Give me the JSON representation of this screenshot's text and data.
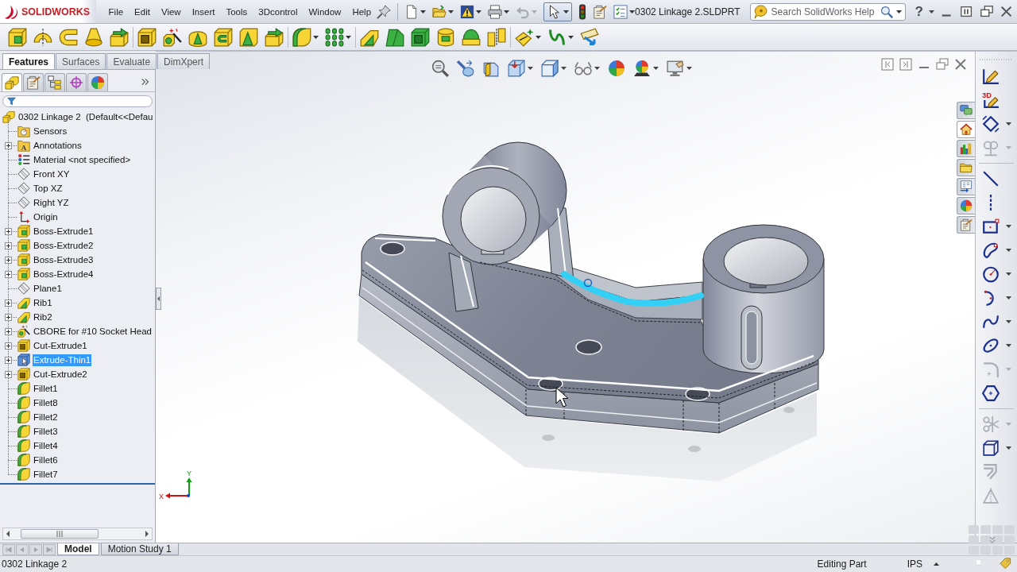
{
  "app": {
    "logo": "SOLIDWORKS"
  },
  "menu": [
    {
      "label": "File"
    },
    {
      "label": "Edit"
    },
    {
      "label": "View"
    },
    {
      "label": "Insert"
    },
    {
      "label": "Tools"
    },
    {
      "label": "3Dcontrol"
    },
    {
      "label": "Window"
    },
    {
      "label": "Help"
    }
  ],
  "quick_access": {
    "undo": {
      "disabled": true
    },
    "select": {
      "selected": true
    }
  },
  "document_title": "0302 Linkage 2.SLDPRT",
  "search": {
    "placeholder": "Search SolidWorks Help"
  },
  "help": {
    "label": "?"
  },
  "command_tabs": [
    {
      "label": "Features",
      "selected": true
    },
    {
      "label": "Surfaces",
      "selected": false
    },
    {
      "label": "Evaluate",
      "selected": false
    },
    {
      "label": "DimXpert",
      "selected": false
    }
  ],
  "manager_tabs": [
    {
      "selected": true
    },
    {
      "selected": false
    },
    {
      "selected": false
    },
    {
      "selected": false
    },
    {
      "selected": false
    }
  ],
  "feature_tree": {
    "root": {
      "label": "0302 Linkage 2  (Default<<Defau"
    },
    "items": [
      {
        "label": "Sensors",
        "kind": "sensors",
        "expandable": false,
        "selected": false
      },
      {
        "label": "Annotations",
        "kind": "annotations",
        "icon_text": "A",
        "expandable": true,
        "selected": false
      },
      {
        "label": "Material <not specified>",
        "kind": "material",
        "expandable": false,
        "selected": false
      },
      {
        "label": "Front XY",
        "kind": "plane",
        "expandable": false,
        "selected": false
      },
      {
        "label": "Top XZ",
        "kind": "plane",
        "expandable": false,
        "selected": false
      },
      {
        "label": "Right YZ",
        "kind": "plane",
        "expandable": false,
        "selected": false
      },
      {
        "label": "Origin",
        "kind": "origin",
        "expandable": false,
        "selected": false
      },
      {
        "label": "Boss-Extrude1",
        "kind": "boss",
        "expandable": true,
        "selected": false
      },
      {
        "label": "Boss-Extrude2",
        "kind": "boss",
        "expandable": true,
        "selected": false
      },
      {
        "label": "Boss-Extrude3",
        "kind": "boss",
        "expandable": true,
        "selected": false
      },
      {
        "label": "Boss-Extrude4",
        "kind": "boss",
        "expandable": true,
        "selected": false
      },
      {
        "label": "Plane1",
        "kind": "plane",
        "expandable": false,
        "selected": false
      },
      {
        "label": "Rib1",
        "kind": "rib",
        "expandable": true,
        "selected": false
      },
      {
        "label": "Rib2",
        "kind": "rib",
        "expandable": true,
        "selected": false
      },
      {
        "label": "CBORE for #10 Socket Head",
        "kind": "hole",
        "expandable": true,
        "selected": false
      },
      {
        "label": "Cut-Extrude1",
        "kind": "cut",
        "expandable": true,
        "selected": false
      },
      {
        "label": "Extrude-Thin1",
        "kind": "thin",
        "expandable": true,
        "selected": true
      },
      {
        "label": "Cut-Extrude2",
        "kind": "cut",
        "expandable": true,
        "selected": false
      },
      {
        "label": "Fillet1",
        "kind": "fillet",
        "expandable": false,
        "selected": false
      },
      {
        "label": "Fillet8",
        "kind": "fillet",
        "expandable": false,
        "selected": false
      },
      {
        "label": "Fillet2",
        "kind": "fillet",
        "expandable": false,
        "selected": false
      },
      {
        "label": "Fillet3",
        "kind": "fillet",
        "expandable": false,
        "selected": false
      },
      {
        "label": "Fillet4",
        "kind": "fillet",
        "expandable": false,
        "selected": false
      },
      {
        "label": "Fillet6",
        "kind": "fillet",
        "expandable": false,
        "selected": false
      },
      {
        "label": "Fillet7",
        "kind": "fillet",
        "expandable": false,
        "selected": false
      }
    ]
  },
  "part_model": {
    "highlighted": true
  },
  "triad": {
    "x_label": "X",
    "y_label": "Y"
  },
  "task_pane_tabs": [
    {
      "selected": false
    },
    {
      "selected": true
    },
    {
      "selected": false
    },
    {
      "selected": false
    },
    {
      "selected": false
    },
    {
      "selected": false
    },
    {
      "selected": false
    }
  ],
  "sketch_toolbar": [
    {
      "disabled": false
    },
    {
      "disabled": false,
      "badge": "3D"
    },
    {
      "disabled": false
    },
    {
      "disabled": true
    },
    {
      "disabled": false
    },
    {
      "disabled": false
    },
    {
      "disabled": false
    },
    {
      "disabled": false
    },
    {
      "disabled": false
    },
    {
      "disabled": false
    },
    {
      "disabled": false
    },
    {
      "disabled": false
    },
    {
      "disabled": true
    },
    {
      "disabled": false
    },
    {
      "disabled": true
    },
    {
      "disabled": false
    },
    {
      "disabled": true
    },
    {
      "disabled": true
    }
  ],
  "bottom_tabs": [
    {
      "label": "Model",
      "selected": true
    },
    {
      "label": "Motion Study 1",
      "selected": false
    }
  ],
  "status_bar": {
    "document": "0302 Linkage 2",
    "mode": "Editing Part",
    "units": "IPS"
  }
}
